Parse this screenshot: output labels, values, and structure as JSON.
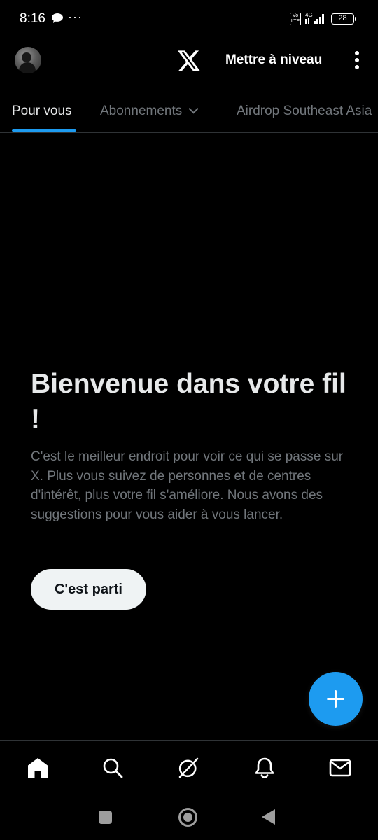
{
  "status_bar": {
    "time": "8:16",
    "overflow": "···",
    "volte": "Vo LTE",
    "network": "4G",
    "battery": "28"
  },
  "header": {
    "logo": "x-logo-icon",
    "upgrade_label": "Mettre à niveau"
  },
  "tabs": [
    {
      "label": "Pour vous",
      "active": true
    },
    {
      "label": "Abonnements",
      "active": false
    },
    {
      "label": "Airdrop Southeast Asia",
      "active": false
    }
  ],
  "welcome": {
    "title": "Bienvenue dans votre fil !",
    "body": "C'est le meilleur endroit pour voir ce qui se passe sur X. Plus vous suivez de personnes et de centres d'intérêt, plus votre fil s'améliore. Nous avons des suggestions pour vous aider à vous lancer.",
    "button_label": "C'est parti"
  },
  "fab": {
    "icon": "plus-icon"
  },
  "bottom_nav": [
    "home-icon",
    "search-icon",
    "grok-icon",
    "bell-icon",
    "mail-icon"
  ],
  "colors": {
    "background": "#000000",
    "accent": "#1d9bf0",
    "primary_text": "#e7e9ea",
    "secondary_text": "#71767b"
  }
}
